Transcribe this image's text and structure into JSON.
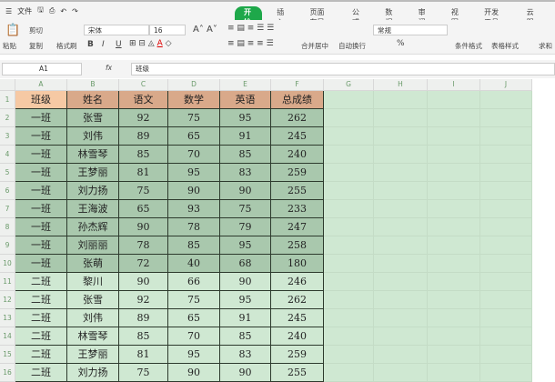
{
  "menu": {
    "file": "文件",
    "items": [
      "开始",
      "插入",
      "页面布局",
      "公式",
      "数据",
      "审阅",
      "视图",
      "开发工具",
      "云服务"
    ],
    "active": 0
  },
  "toolbar": {
    "paste": "粘贴",
    "cut": "剪切",
    "copy": "复制",
    "format_painter": "格式刷",
    "font": "宋体",
    "font_size": "16",
    "bold": "B",
    "italic": "I",
    "underline": "U",
    "merge_center": "合并居中",
    "wrap_text": "自动换行",
    "number_format": "常规",
    "percent": "%",
    "cond_format": "条件格式",
    "table_style": "表格样式",
    "sum": "求和"
  },
  "formula_bar": {
    "cell_ref": "A1",
    "fx": "fx",
    "value": "班级"
  },
  "columns": [
    "A",
    "B",
    "C",
    "D",
    "E",
    "F",
    "G",
    "H",
    "I",
    "J"
  ],
  "table": {
    "headers": [
      "班级",
      "姓名",
      "语文",
      "数学",
      "英语",
      "总成绩"
    ],
    "rows": [
      [
        "一班",
        "张雪",
        "92",
        "75",
        "95",
        "262"
      ],
      [
        "一班",
        "刘伟",
        "89",
        "65",
        "91",
        "245"
      ],
      [
        "一班",
        "林雪琴",
        "85",
        "70",
        "85",
        "240"
      ],
      [
        "一班",
        "王梦丽",
        "81",
        "95",
        "83",
        "259"
      ],
      [
        "一班",
        "刘力扬",
        "75",
        "90",
        "90",
        "255"
      ],
      [
        "一班",
        "王海波",
        "65",
        "93",
        "75",
        "233"
      ],
      [
        "一班",
        "孙杰辉",
        "90",
        "78",
        "79",
        "247"
      ],
      [
        "一班",
        "刘丽丽",
        "78",
        "85",
        "95",
        "258"
      ],
      [
        "一班",
        "张萌",
        "72",
        "40",
        "68",
        "180"
      ],
      [
        "二班",
        "黎川",
        "90",
        "66",
        "90",
        "246"
      ],
      [
        "二班",
        "张雪",
        "92",
        "75",
        "95",
        "262"
      ],
      [
        "二班",
        "刘伟",
        "89",
        "65",
        "91",
        "245"
      ],
      [
        "二班",
        "林雪琴",
        "85",
        "70",
        "85",
        "240"
      ],
      [
        "二班",
        "王梦丽",
        "81",
        "95",
        "83",
        "259"
      ],
      [
        "二班",
        "刘力扬",
        "75",
        "90",
        "90",
        "255"
      ]
    ]
  },
  "colors": {
    "header": "#d9a98a",
    "active_header": "#f6c9a4",
    "selected": "#a9c8ad",
    "unselected": "#cfe8d2",
    "arrow": "#e02020"
  }
}
